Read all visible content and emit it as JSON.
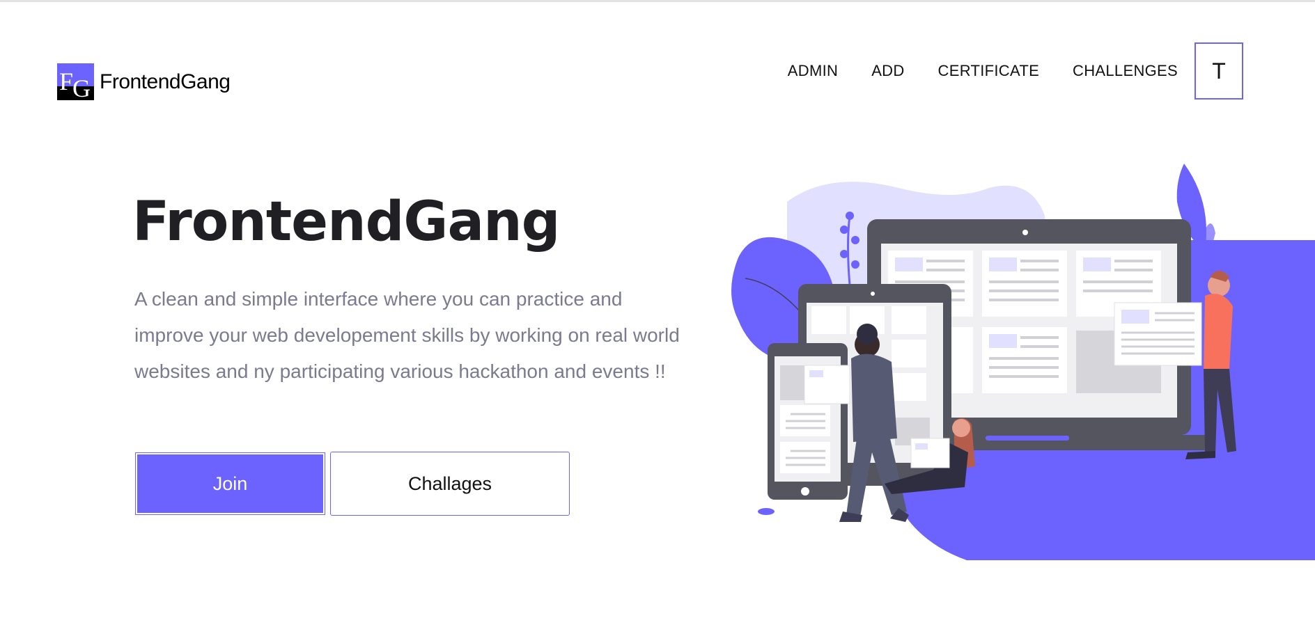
{
  "header": {
    "logo_text": "FrontendGang",
    "logo_mark_f": "F",
    "logo_mark_g": "G",
    "nav": [
      {
        "label": "ADMIN"
      },
      {
        "label": "ADD"
      },
      {
        "label": "CERTIFICATE"
      },
      {
        "label": "CHALLENGES"
      }
    ],
    "avatar_initial": "T"
  },
  "hero": {
    "title": "FrontendGang",
    "description": "A clean and simple interface where you can practice and improve your web developement skills by working on real world websites and ny participating various hackathon and events !!",
    "join_label": "Join",
    "challenges_label": "Challages"
  },
  "colors": {
    "accent": "#6c63ff",
    "text_dark": "#1f1f24",
    "text_muted": "#7a7a90"
  },
  "illustration": {
    "icon": "web-development-team-illustration"
  }
}
